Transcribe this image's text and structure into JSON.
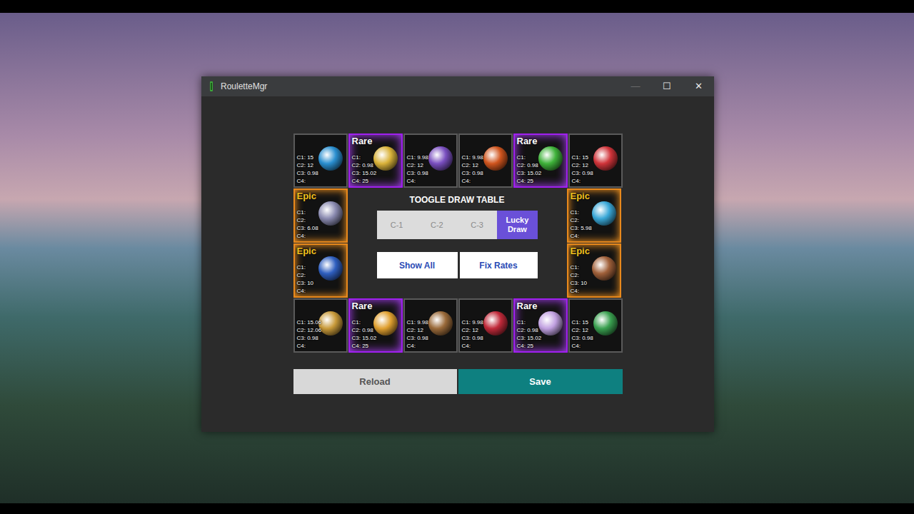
{
  "window": {
    "title": "RouletteMgr",
    "controls": [
      {
        "label": "—",
        "disabled": true
      },
      {
        "label": "☐",
        "disabled": false
      },
      {
        "label": "✕",
        "disabled": false
      }
    ]
  },
  "grid": {
    "top": [
      {
        "kind": "normal",
        "badge": "",
        "color": "#2a8fd0",
        "stats": [
          "C1: 15",
          "C2: 12",
          "C3: 0.98",
          "C4:"
        ]
      },
      {
        "kind": "rare",
        "badge": "Rare",
        "color": "#d9b23a",
        "stats": [
          "C1:",
          "C2: 0.98",
          "C3: 15.02",
          "C4: 25"
        ]
      },
      {
        "kind": "normal",
        "badge": "",
        "color": "#7a4fc0",
        "stats": [
          "C1: 9.98",
          "C2: 12",
          "C3: 0.98",
          "C4:"
        ]
      },
      {
        "kind": "normal",
        "badge": "",
        "color": "#d0551e",
        "stats": [
          "C1: 9.98",
          "C2: 12",
          "C3: 0.98",
          "C4:"
        ]
      },
      {
        "kind": "rare",
        "badge": "Rare",
        "color": "#3fb23a",
        "stats": [
          "C1:",
          "C2: 0.98",
          "C3: 15.02",
          "C4: 25"
        ]
      },
      {
        "kind": "normal",
        "badge": "",
        "color": "#d0343a",
        "stats": [
          "C1: 15",
          "C2: 12",
          "C3: 0.98",
          "C4:"
        ]
      }
    ],
    "left": [
      {
        "kind": "epic",
        "badge": "Epic",
        "color": "#8a8ab0",
        "stats": [
          "C1:",
          "C2:",
          "C3: 6.08",
          "C4:"
        ]
      },
      {
        "kind": "epic",
        "badge": "Epic",
        "color": "#2f5fc0",
        "stats": [
          "C1:",
          "C2:",
          "C3: 10",
          "C4:"
        ]
      }
    ],
    "right": [
      {
        "kind": "epic",
        "badge": "Epic",
        "color": "#3aa8d8",
        "stats": [
          "C1:",
          "C2:",
          "C3: 5.98",
          "C4:"
        ]
      },
      {
        "kind": "epic",
        "badge": "Epic",
        "color": "#a0603a",
        "stats": [
          "C1:",
          "C2:",
          "C3: 10",
          "C4:"
        ]
      }
    ],
    "bottom": [
      {
        "kind": "normal",
        "badge": "",
        "color": "#c89a3a",
        "stats": [
          "C1: 15.06",
          "C2: 12.06",
          "C3: 0.98",
          "C4:"
        ]
      },
      {
        "kind": "rare",
        "badge": "Rare",
        "color": "#e0a030",
        "stats": [
          "C1:",
          "C2: 0.98",
          "C3: 15.02",
          "C4: 25"
        ]
      },
      {
        "kind": "normal",
        "badge": "",
        "color": "#9a6a3a",
        "stats": [
          "C1: 9.98",
          "C2: 12",
          "C3: 0.98",
          "C4:"
        ]
      },
      {
        "kind": "normal",
        "badge": "",
        "color": "#c02a3a",
        "stats": [
          "C1: 9.98",
          "C2: 12",
          "C3: 0.98",
          "C4:"
        ]
      },
      {
        "kind": "rare",
        "badge": "Rare",
        "color": "#c0a0e0",
        "stats": [
          "C1:",
          "C2: 0.98",
          "C3: 15.02",
          "C4: 25"
        ]
      },
      {
        "kind": "normal",
        "badge": "",
        "color": "#3aa050",
        "stats": [
          "C1: 15",
          "C2: 12",
          "C3: 0.98",
          "C4:"
        ]
      }
    ]
  },
  "draw_table": {
    "title": "TOOGLE DRAW TABLE",
    "tabs": [
      {
        "label": "C-1",
        "selected": false
      },
      {
        "label": "C-2",
        "selected": false
      },
      {
        "label": "C-3",
        "selected": false
      },
      {
        "label": "Lucky Draw",
        "selected": true
      }
    ]
  },
  "actions": [
    "Show All",
    "Fix Rates"
  ],
  "footer": {
    "reload": "Reload",
    "save": "Save"
  }
}
